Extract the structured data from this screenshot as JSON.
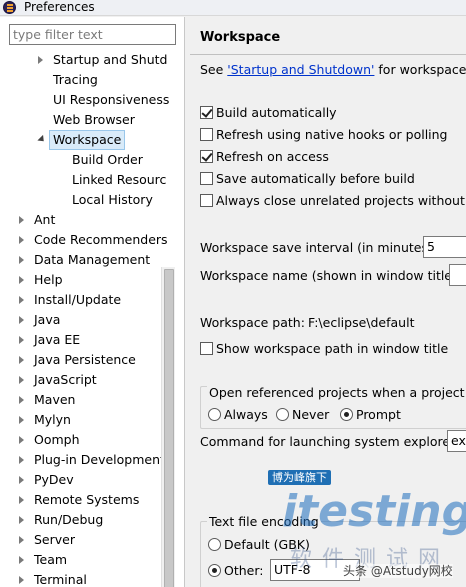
{
  "window": {
    "title": "Preferences"
  },
  "filter": {
    "placeholder": "type filter text"
  },
  "tree": {
    "items": [
      {
        "label": "Startup and Shutd",
        "expander": "collapsed"
      },
      {
        "label": "Tracing"
      },
      {
        "label": "UI Responsiveness"
      },
      {
        "label": "Web Browser"
      },
      {
        "label": "Workspace",
        "expander": "expanded",
        "selected": true
      },
      {
        "label": "Build Order"
      },
      {
        "label": "Linked Resourc"
      },
      {
        "label": "Local History"
      },
      {
        "label": "Ant",
        "expander": "collapsed"
      },
      {
        "label": "Code Recommenders",
        "expander": "collapsed"
      },
      {
        "label": "Data Management",
        "expander": "collapsed"
      },
      {
        "label": "Help",
        "expander": "collapsed"
      },
      {
        "label": "Install/Update",
        "expander": "collapsed"
      },
      {
        "label": "Java",
        "expander": "collapsed"
      },
      {
        "label": "Java EE",
        "expander": "collapsed"
      },
      {
        "label": "Java Persistence",
        "expander": "collapsed"
      },
      {
        "label": "JavaScript",
        "expander": "collapsed"
      },
      {
        "label": "Maven",
        "expander": "collapsed"
      },
      {
        "label": "Mylyn",
        "expander": "collapsed"
      },
      {
        "label": "Oomph",
        "expander": "collapsed"
      },
      {
        "label": "Plug-in Development",
        "expander": "collapsed"
      },
      {
        "label": "PyDev",
        "expander": "collapsed"
      },
      {
        "label": "Remote Systems",
        "expander": "collapsed"
      },
      {
        "label": "Run/Debug",
        "expander": "collapsed"
      },
      {
        "label": "Server",
        "expander": "collapsed"
      },
      {
        "label": "Team",
        "expander": "collapsed"
      },
      {
        "label": "Terminal",
        "expander": "collapsed"
      }
    ]
  },
  "page": {
    "title": "Workspace",
    "see_prefix": "See ",
    "see_link": "'Startup and Shutdown'",
    "see_suffix": " for workspace sta",
    "checkboxes": [
      {
        "label": "Build automatically",
        "checked": true
      },
      {
        "label": "Refresh using native hooks or polling",
        "checked": false
      },
      {
        "label": "Refresh on access",
        "checked": true
      },
      {
        "label": "Save automatically before build",
        "checked": false
      },
      {
        "label": "Always close unrelated projects without pro",
        "checked": false
      }
    ],
    "save_interval_label": "Workspace save interval (in minutes):",
    "save_interval_value": "5",
    "workspace_name_label": "Workspace name (shown in window title):",
    "workspace_name_value": "",
    "workspace_path_label": "Workspace path:",
    "workspace_path_value": "F:\\eclipse\\default",
    "show_path_label": "Show workspace path in window title",
    "show_path_checked": false,
    "open_referenced": {
      "title": "Open referenced projects when a project is",
      "options": [
        {
          "label": "Always",
          "checked": false
        },
        {
          "label": "Never",
          "checked": false
        },
        {
          "label": "Prompt",
          "checked": true
        }
      ]
    },
    "explorer_label": "Command for launching system explorer:",
    "explorer_value": "ex",
    "encoding": {
      "title": "Text file encoding",
      "default_label": "Default (GBK)",
      "default_checked": false,
      "other_label": "Other:",
      "other_checked": true,
      "other_value": "UTF-8"
    }
  },
  "watermark": {
    "badge": "博为峰旗下",
    "logo": "itesting",
    "chinese": "软件测试网",
    "credit": "头条 @Atstudy网校"
  },
  "colors": {
    "selection_bg": "#d9ebf9",
    "selection_border": "#9ac7ea",
    "link": "#0033cc",
    "panel_bg": "#f0f0f0"
  }
}
